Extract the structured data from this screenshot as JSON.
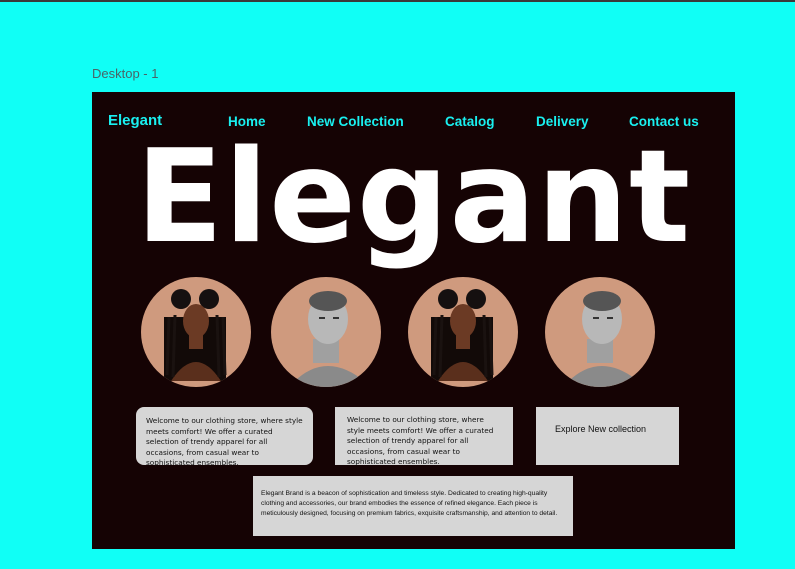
{
  "canvas": {
    "frame_label": "Desktop - 1"
  },
  "colors": {
    "canvas_bg": "#10fff6",
    "frame_bg": "#150304",
    "accent": "#19f0f0",
    "circle_bg": "#cf9a7e",
    "card_bg": "#d6d6d6"
  },
  "header": {
    "brand": "Elegant",
    "nav": [
      "Home",
      "New Collection",
      "Catalog",
      "Delivery",
      "Contact us"
    ]
  },
  "hero": {
    "title": "Elegant"
  },
  "gallery": [
    {
      "icon": "woman-portrait-icon"
    },
    {
      "icon": "man-portrait-icon"
    },
    {
      "icon": "woman-portrait-icon"
    },
    {
      "icon": "man-portrait-icon"
    }
  ],
  "cards": {
    "welcome_1": "Welcome to our clothing store, where style meets comfort! We offer a curated selection of trendy apparel for all occasions, from casual wear to sophisticated ensembles.",
    "welcome_2": "Welcome to our clothing store, where style meets comfort! We offer a curated selection of trendy apparel for all occasions, from casual wear to sophisticated ensembles.",
    "explore": "Explore New collection",
    "brand_text": "Elegant Brand is a beacon of sophistication and timeless style. Dedicated to creating high-quality clothing and accessories, our brand embodies the essence of refined elegance. Each piece is meticulously designed, focusing on premium fabrics, exquisite craftsmanship, and attention to detail."
  }
}
